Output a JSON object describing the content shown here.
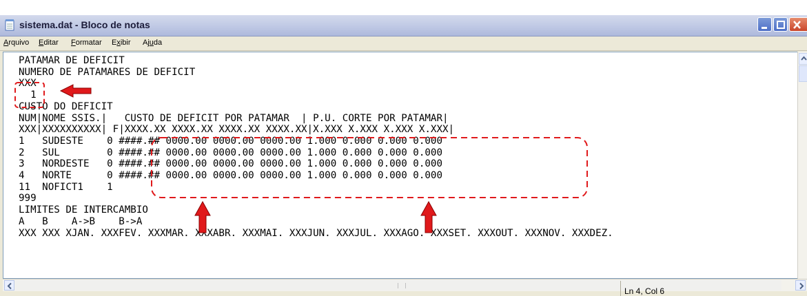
{
  "window": {
    "title": "sistema.dat - Bloco de notas"
  },
  "menu": {
    "items": [
      {
        "pre": "",
        "accel": "A",
        "post": "rquivo"
      },
      {
        "pre": "",
        "accel": "E",
        "post": "ditar"
      },
      {
        "pre": "",
        "accel": "F",
        "post": "ormatar"
      },
      {
        "pre": "E",
        "accel": "x",
        "post": "ibir"
      },
      {
        "pre": "Aj",
        "accel": "u",
        "post": "da"
      }
    ]
  },
  "editor": {
    "lines": [
      "PATAMAR DE DEFICIT",
      "NUMERO DE PATAMARES DE DEFICIT",
      "XXX",
      "  1",
      "CUSTO DO DEFICIT",
      "NUM|NOME SSIS.|   CUSTO DE DEFICIT POR PATAMAR  | P.U. CORTE POR PATAMAR|",
      "XXX|XXXXXXXXXX| F|XXXX.XX XXXX.XX XXXX.XX XXXX.XX|X.XXX X.XXX X.XXX X.XXX|",
      "1   SUDESTE    0 ####.## 0000.00 0000.00 0000.00 1.000 0.000 0.000 0.000",
      "2   SUL        0 ####.## 0000.00 0000.00 0000.00 1.000 0.000 0.000 0.000",
      "3   NORDESTE   0 ####.## 0000.00 0000.00 0000.00 1.000 0.000 0.000 0.000",
      "4   NORTE      0 ####.## 0000.00 0000.00 0000.00 1.000 0.000 0.000 0.000",
      "11  NOFICT1    1",
      "999",
      "LIMITES DE INTERCAMBIO",
      "A   B    A->B    B->A",
      "XXX XXX XJAN. XXXFEV. XXXMAR. XXXABR. XXXMAI. XXXJUN. XXXJUL. XXXAGO. XXXSET. XXXOUT. XXXNOV. XXXDEZ."
    ]
  },
  "status": {
    "position": "Ln 4, Col 6"
  },
  "annotation_color": "#e0191b",
  "icons": [
    "notepad-icon",
    "minimize-icon",
    "maximize-icon",
    "close-icon",
    "scroll-up-icon",
    "scroll-left-icon",
    "scroll-right-icon"
  ]
}
